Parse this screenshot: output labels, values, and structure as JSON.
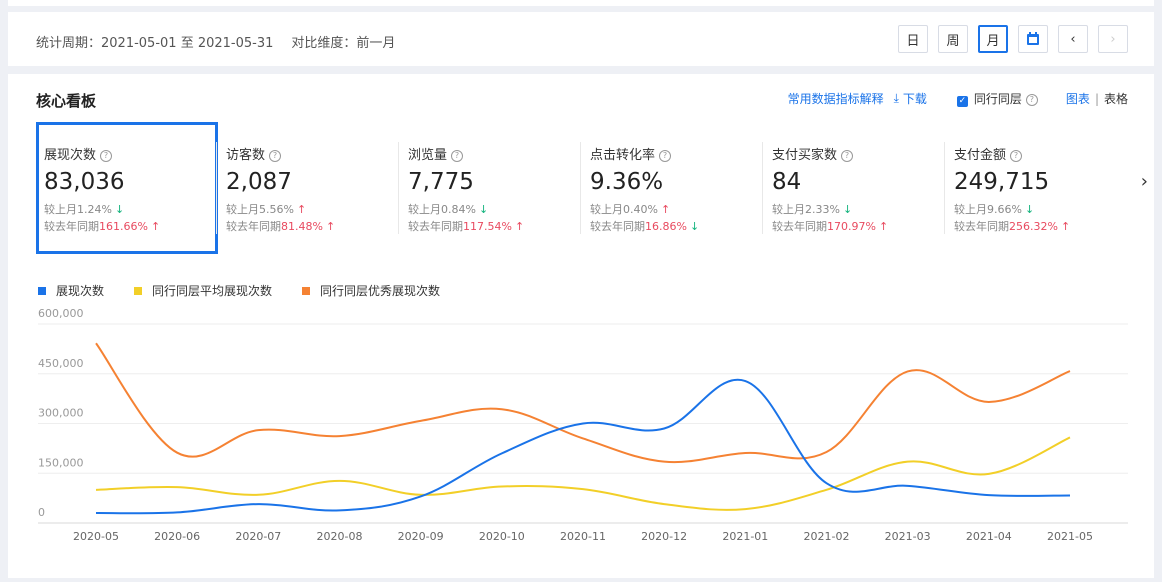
{
  "period": {
    "label": "统计周期：",
    "range": "2021-05-01 至 2021-05-31",
    "compare_label": "对比维度：",
    "compare_value": "前一月",
    "buttons": [
      "日",
      "周",
      "月"
    ],
    "active": "月"
  },
  "board": {
    "title": "核心看板",
    "explain_link": "常用数据指标解释",
    "download": "下载",
    "peer_checkbox": "同行同层",
    "view_chart": "图表",
    "view_sep": "|",
    "view_table": "表格"
  },
  "kpis": [
    {
      "label": "展现次数",
      "value": "83,036",
      "mom_label": "较上月",
      "mom": "1.24%",
      "mom_dir": "down",
      "yoy_label": "较去年同期",
      "yoy": "161.66%",
      "yoy_dir": "up"
    },
    {
      "label": "访客数",
      "value": "2,087",
      "mom_label": "较上月",
      "mom": "5.56%",
      "mom_dir": "up",
      "yoy_label": "较去年同期",
      "yoy": "81.48%",
      "yoy_dir": "up"
    },
    {
      "label": "浏览量",
      "value": "7,775",
      "mom_label": "较上月",
      "mom": "0.84%",
      "mom_dir": "down",
      "yoy_label": "较去年同期",
      "yoy": "117.54%",
      "yoy_dir": "up"
    },
    {
      "label": "点击转化率",
      "value": "9.36%",
      "mom_label": "较上月",
      "mom": "0.40%",
      "mom_dir": "up",
      "yoy_label": "较去年同期",
      "yoy": "16.86%",
      "yoy_dir": "down"
    },
    {
      "label": "支付买家数",
      "value": "84",
      "mom_label": "较上月",
      "mom": "2.33%",
      "mom_dir": "down",
      "yoy_label": "较去年同期",
      "yoy": "170.97%",
      "yoy_dir": "up"
    },
    {
      "label": "支付金额",
      "value": "249,715",
      "mom_label": "较上月",
      "mom": "9.66%",
      "mom_dir": "down",
      "yoy_label": "较去年同期",
      "yoy": "256.32%",
      "yoy_dir": "up"
    }
  ],
  "colors": {
    "accent": "#1a73e8",
    "up": "#e84a5f",
    "down": "#14b37d",
    "series": [
      "#1a73e8",
      "#f2cf28",
      "#f58233"
    ]
  },
  "chart_data": {
    "type": "line",
    "categories": [
      "2020-05",
      "2020-06",
      "2020-07",
      "2020-08",
      "2020-09",
      "2020-10",
      "2020-11",
      "2020-12",
      "2021-01",
      "2021-02",
      "2021-03",
      "2021-04",
      "2021-05"
    ],
    "ylim": [
      0,
      600000
    ],
    "yticks": [
      0,
      150000,
      300000,
      450000,
      600000
    ],
    "ytick_labels": [
      "0",
      "150,000",
      "300,000",
      "450,000",
      "600,000"
    ],
    "grid": true,
    "legend": "top-left",
    "series": [
      {
        "name": "展现次数",
        "values": [
          30000,
          32000,
          57000,
          38000,
          80000,
          210000,
          300000,
          285000,
          428000,
          120000,
          112000,
          84000,
          83036
        ]
      },
      {
        "name": "同行同层平均展现次数",
        "values": [
          100000,
          108000,
          85000,
          127000,
          85000,
          110000,
          102000,
          57000,
          42000,
          100000,
          185000,
          148000,
          258000
        ]
      },
      {
        "name": "同行同层优秀展现次数",
        "values": [
          542000,
          212000,
          280000,
          262000,
          308000,
          343000,
          255000,
          185000,
          211000,
          214000,
          457000,
          365000,
          458000
        ]
      }
    ]
  }
}
